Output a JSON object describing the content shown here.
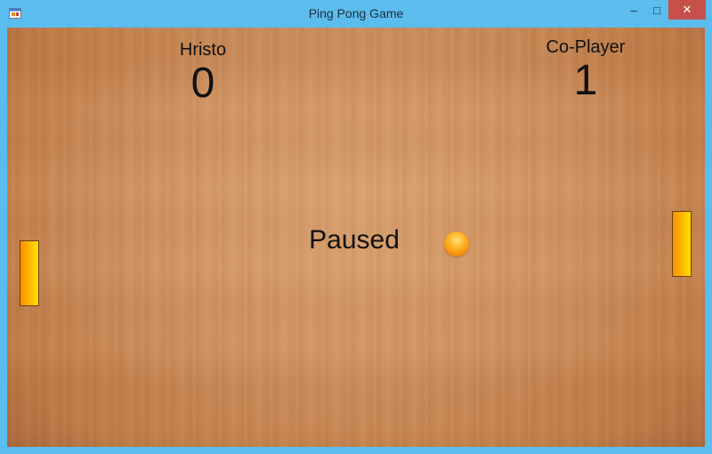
{
  "window": {
    "title": "Ping Pong Game",
    "minimize_glyph": "‒",
    "maximize_glyph": "□",
    "close_glyph": "✕",
    "icon": "app-window-icon"
  },
  "players": {
    "left": {
      "name": "Hristo",
      "score": "0"
    },
    "right": {
      "name": "Co-Player",
      "score": "1"
    }
  },
  "game": {
    "status": "Paused"
  },
  "colors": {
    "titlebar": "#5bbcee",
    "close_button": "#c7504a",
    "table_wood": "#cf9260",
    "paddle_start": "#ff8c00",
    "paddle_end": "#ffe000",
    "ball": "#ffb224"
  }
}
